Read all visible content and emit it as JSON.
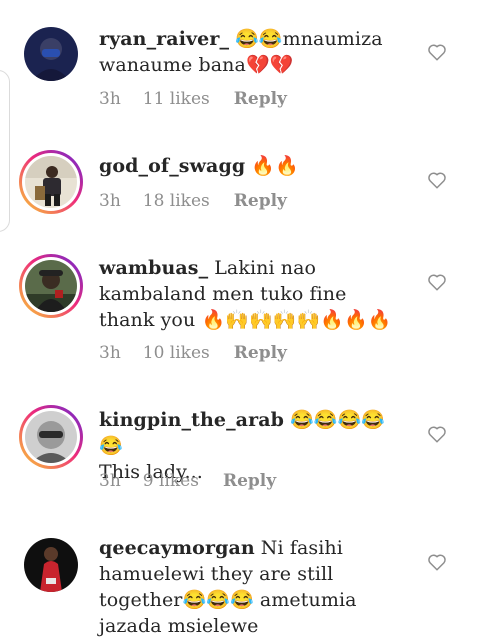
{
  "comments": [
    {
      "username": "ryan_raiver_",
      "text_lines": [
        "😂😂mnaumiza",
        "wanaume bana💔💔"
      ],
      "time": "3h",
      "likes": "11 likes",
      "reply": "Reply"
    },
    {
      "username": "god_of_swagg",
      "text_lines": [
        "🔥🔥"
      ],
      "time": "3h",
      "likes": "18 likes",
      "reply": "Reply"
    },
    {
      "username": "wambuas_",
      "text_lines": [
        "Lakini nao",
        "kambaland men tuko fine",
        "thank you 🔥🙌🙌🙌🙌🔥🔥🔥"
      ],
      "time": "3h",
      "likes": "10 likes",
      "reply": "Reply"
    },
    {
      "username": "kingpin_the_arab",
      "text_lines": [
        "😂😂😂😂😂",
        "This lady..."
      ],
      "time": "3h",
      "likes": "9 likes",
      "reply": "Reply"
    },
    {
      "username": "qeecaymorgan",
      "text_lines": [
        "Ni fasihi",
        "hamuelewi they are still",
        "together😂😂😂 ametumia",
        "jazada msielewe"
      ],
      "time": "",
      "likes": "",
      "reply": ""
    }
  ],
  "icons": {
    "like": "heart-outline-icon"
  },
  "colors": {
    "meta": "#8e8e8e",
    "text": "#262626",
    "story_ring_start": "#f9ce34",
    "story_ring_end": "#6228d7"
  }
}
